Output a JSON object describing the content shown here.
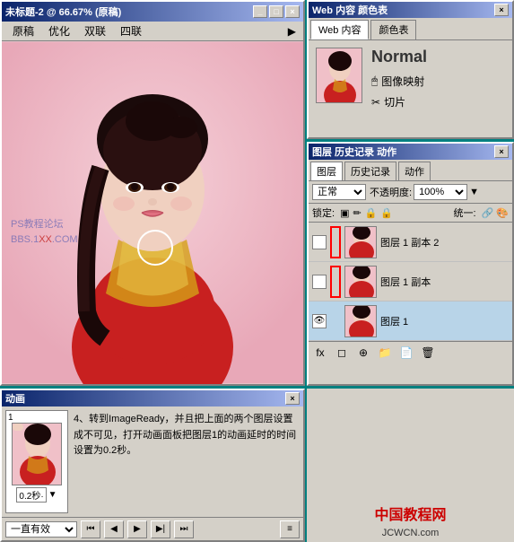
{
  "mainWindow": {
    "title": "未标题-2 @ 66.67% (原稿)",
    "tabs": [
      "原稿",
      "优化",
      "双联",
      "四联"
    ],
    "scale": "66.67%"
  },
  "rightTopPanel": {
    "tabs": [
      "Web 内容",
      "颜色表"
    ],
    "activeTab": "Web 内容",
    "normalLabel": "Normal",
    "options": [
      "图像映射",
      "切片"
    ]
  },
  "layersPanel": {
    "title": "图层 历史记录 动作",
    "tabs": [
      "图层",
      "历史记录",
      "动作"
    ],
    "mode": "正常",
    "opacity": "不透明度: 100%",
    "lockLabel": "锁定:",
    "fillLabel": "统一:",
    "layers": [
      {
        "name": "图层 1 副本 2",
        "hasRedBox": true
      },
      {
        "name": "图层 1 副本",
        "hasRedBox": true
      },
      {
        "name": "图层 1",
        "hasRedBox": false
      }
    ]
  },
  "animPanel": {
    "title": "动画",
    "frame": {
      "number": "1",
      "time": "0.2秒·"
    },
    "text": "4、转到ImageReady，并且把上面的两个图层设置成不可见，打开动画面板把图层1的动画延时的时间设置为0.2秒。",
    "bottomControls": {
      "loopOption": "一直有效",
      "buttons": [
        "⏮",
        "◀",
        "▶",
        "▶▶",
        "⏭"
      ]
    }
  },
  "bottomRight": {
    "brand": "中国教程网",
    "url": "JCWCN.com"
  },
  "icons": {
    "minimize": "_",
    "maximize": "□",
    "close": "×",
    "eye": "👁",
    "arrow": "▶"
  }
}
